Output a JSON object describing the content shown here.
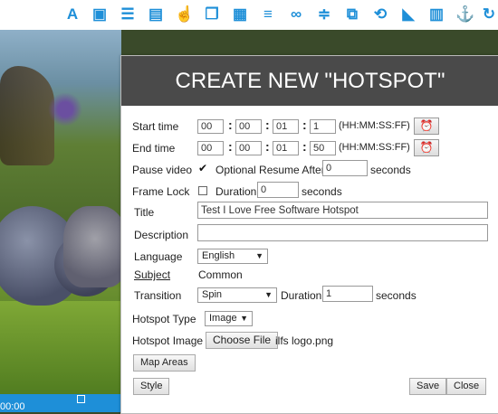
{
  "toolbar": {
    "icons": [
      "text-icon",
      "image-icon",
      "list-icon",
      "document-icon",
      "hand-icon",
      "copy-icon",
      "calendar-icon",
      "list-bold-icon",
      "link-icon",
      "sliders-icon",
      "crop-icon",
      "refresh-icon",
      "speaker-icon",
      "table-icon",
      "anchor-icon",
      "rotate-icon"
    ]
  },
  "video": {
    "timecode": "00:00"
  },
  "dialog": {
    "title": "CREATE NEW \"HOTSPOT\"",
    "start_time": {
      "label": "Start time",
      "hh": "00",
      "mm": "00",
      "ss": "01",
      "ff": "1",
      "format": "(HH:MM:SS:FF)"
    },
    "end_time": {
      "label": "End time",
      "hh": "00",
      "mm": "00",
      "ss": "01",
      "ff": "50",
      "format": "(HH:MM:SS:FF)"
    },
    "pause_video": {
      "label": "Pause video",
      "checked": "✔",
      "resume_label": "Optional Resume After",
      "resume_value": "0",
      "unit": "seconds"
    },
    "frame_lock": {
      "label": "Frame Lock",
      "duration_label": "Duration",
      "duration_value": "0",
      "unit": "seconds"
    },
    "title_field": {
      "label": "Title",
      "value": "Test I Love Free Software Hotspot"
    },
    "description": {
      "label": "Description",
      "value": ""
    },
    "language": {
      "label": "Language",
      "value": "English"
    },
    "subject": {
      "label": "Subject",
      "value": "Common"
    },
    "transition": {
      "label": "Transition",
      "value": "Spin",
      "duration_label": "Duration",
      "duration_value": "1",
      "unit": "seconds"
    },
    "hotspot_type": {
      "label": "Hotspot Type",
      "value": "Image"
    },
    "hotspot_image": {
      "label": "Hotspot Image",
      "button": "Choose File",
      "filename": "ilfs logo.png"
    },
    "map_areas_button": "Map Areas",
    "style_button": "Style",
    "save_button": "Save",
    "close_button": "Close",
    "clock_glyph": "⏰",
    "colon": ":"
  }
}
